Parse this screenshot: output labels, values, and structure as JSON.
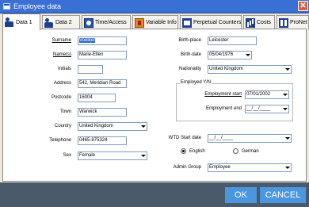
{
  "window": {
    "title": "Employee data",
    "close_glyph": "✕"
  },
  "tabs": [
    {
      "label": "Data 1",
      "icon": "people-icon"
    },
    {
      "label": "Data 2",
      "icon": "people-icon"
    },
    {
      "label": "Time/Access",
      "icon": "clock-icon"
    },
    {
      "label": "Variable Info",
      "icon": "variable-icon"
    },
    {
      "label": "Perpetual Counters",
      "icon": "counter-icon"
    },
    {
      "label": "Costs",
      "icon": "chart-icon"
    },
    {
      "label": "ProNet",
      "icon": "network-icon"
    }
  ],
  "left": {
    "surname": {
      "label": "Surname",
      "value": "Voelker"
    },
    "names": {
      "label": "Name(s)",
      "value": "Marie-Ellen"
    },
    "initials": {
      "label": "Initials",
      "value": ""
    },
    "address": {
      "label": "Address",
      "value": "542, Meridian Road"
    },
    "postcode": {
      "label": "Postcode",
      "value": "16004"
    },
    "town": {
      "label": "Town",
      "value": "Warwick"
    },
    "country": {
      "label": "Country",
      "value": "United Kingdom"
    },
    "telephone": {
      "label": "Telephone",
      "value": "0465-875324"
    },
    "sex": {
      "label": "Sex",
      "value": "Female"
    }
  },
  "right": {
    "birthplace": {
      "label": "Birth-place",
      "value": "Leicester"
    },
    "birthdate": {
      "label": "Birth-date",
      "value": "05/04/1976"
    },
    "nationality": {
      "label": "Nationality",
      "value": "United Kingdom"
    },
    "employed": {
      "title": "Employed Y/N",
      "start_label": "Employment start",
      "start_value": "07/01/2002",
      "end_label": "Employment end",
      "end_value": "__/__/____"
    },
    "wtd": {
      "label": "WTD Start date",
      "value": "__/__/____"
    },
    "language": {
      "option1": "English",
      "option2": "German",
      "selected": "English"
    },
    "admin_group": {
      "label": "Admin Group",
      "value": "Employee"
    }
  },
  "buttons": {
    "ok": "OK",
    "cancel": "CANCEL"
  },
  "colors": {
    "titlebar": "#3a6fd6",
    "accent_button": "#4a97df",
    "footer": "#4b5a6a",
    "selection": "#316ac5"
  }
}
